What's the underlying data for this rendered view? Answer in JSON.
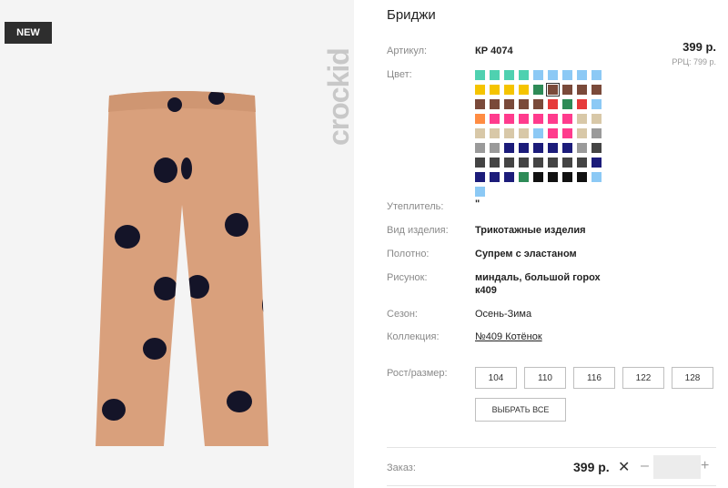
{
  "badge": "NEW",
  "brand": "crockid",
  "product": {
    "title": "Бриджи"
  },
  "details": {
    "article_label": "Артикул:",
    "article_value": "КР 4074",
    "color_label": "Цвет:",
    "insulation_label": "Утеплитель:",
    "insulation_value": "\"",
    "kind_label": "Вид изделия:",
    "kind_value": "Трикотажные изделия",
    "fabric_label": "Полотно:",
    "fabric_value": "Супрем с эластаном",
    "pattern_label": "Рисунок:",
    "pattern_value_1": "миндаль, большой горох",
    "pattern_value_2": "к409",
    "season_label": "Сезон:",
    "season_value": "Осень-Зима",
    "collection_label": "Коллекция:",
    "collection_value": "№409 Котёнок",
    "size_label": "Рост/размер:"
  },
  "price": {
    "value": "399 р.",
    "rrp": "РРЦ: 799 р."
  },
  "swatches": [
    "#4fd1b0",
    "#4fd1b0",
    "#4fd1b0",
    "#4fd1b0",
    "#8cc9f5",
    "#8cc9f5",
    "#8cc9f5",
    "#8cc9f5",
    "#8cc9f5",
    "#f5c400",
    "#f5c400",
    "#f5c400",
    "#f5c400",
    "#2e8b57",
    "#7a4a3a",
    "#7a4a3a",
    "#7a4a3a",
    "#7a4a3a",
    "#7a4a3a",
    "#7a4a3a",
    "#7a4a3a",
    "#7a4a3a",
    "#7a4a3a",
    "#e63a3a",
    "#2e8b57",
    "#e63a3a",
    "#8cc9f5",
    "#ff8c42",
    "#ff3b8d",
    "#ff3b8d",
    "#ff3b8d",
    "#ff3b8d",
    "#ff3b8d",
    "#ff3b8d",
    "#d8c8a8",
    "#d8c8a8",
    "#d8c8a8",
    "#d8c8a8",
    "#d8c8a8",
    "#d8c8a8",
    "#8cc9f5",
    "#ff3b8d",
    "#ff3b8d",
    "#d8c8a8",
    "#9a9a9a",
    "#9a9a9a",
    "#9a9a9a",
    "#1c1c7a",
    "#1c1c7a",
    "#1c1c7a",
    "#1c1c7a",
    "#1c1c7a",
    "#9a9a9a",
    "#444444",
    "#444444",
    "#444444",
    "#444444",
    "#444444",
    "#444444",
    "#444444",
    "#444444",
    "#444444",
    "#1c1c7a",
    "#1c1c7a",
    "#1c1c7a",
    "#1c1c7a",
    "#2e8b57",
    "#111111",
    "#111111",
    "#111111",
    "#111111",
    "#8cc9f5",
    "#8cc9f5"
  ],
  "selected_swatch_index": 14,
  "sizes": [
    "104",
    "110",
    "116",
    "122",
    "128"
  ],
  "select_all": "ВЫБРАТЬ ВСЕ",
  "order": {
    "label": "Заказ:",
    "price": "399 р.",
    "times": "✕",
    "minus": "–",
    "plus": "+"
  }
}
